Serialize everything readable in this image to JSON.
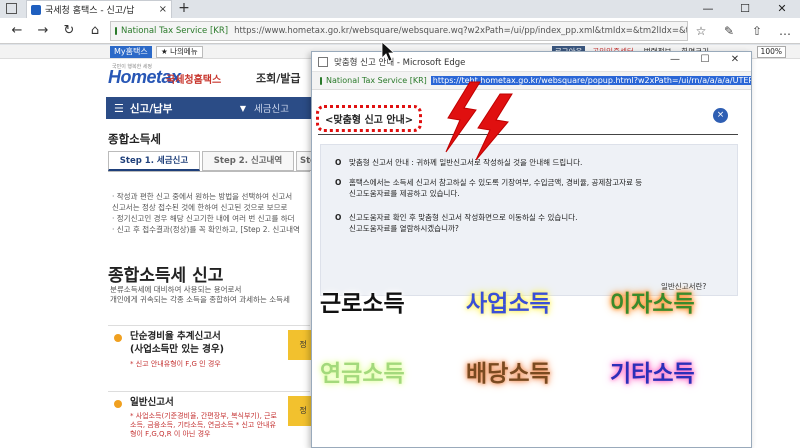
{
  "browser": {
    "tab_title": "국세청 홈택스 - 신고/납",
    "close_glyph": "×",
    "new_tab_glyph": "+",
    "window_controls": [
      "—",
      "☐",
      "✕"
    ],
    "site_identity": "National Tax Service [KR]",
    "url": "https://www.hometax.go.kr/websquare/websquare.wq?w2xPath=/ui/pp/index_pp.xml&tmIdx=&tm2lIdx=&tm3lIdx=",
    "nav": {
      "back": "←",
      "forward": "→",
      "refresh": "↻",
      "home": "⌂"
    },
    "toolbar_glyphs": [
      "☆",
      "✎",
      "⇧",
      "…"
    ]
  },
  "hometax": {
    "myhome": "My홈택스",
    "mymenu": "★ 나의메뉴",
    "toplinks": [
      "로그아웃",
      "공인인증센터",
      "법령정보",
      "화면크기"
    ],
    "zoom": "100%",
    "logo_tiny": "국민이 행복한 세정",
    "logo_main": "Hometax",
    "logo_sub": "국세청홈택스",
    "gnb_item": "조회/발급",
    "navbar_label": "신고/납부",
    "navbar_sub": "세금신고",
    "section_title": "종합소득세",
    "steps": [
      "Step 1. 세금신고",
      "Step 2. 신고내역",
      "Step"
    ],
    "bullets": [
      "· 작성과 편한 신고 중에서 원하는 방법을 선택하여 신고서",
      "  신고서는 정상 접수된 것에 한하여 신고된 것으로 보므로",
      "· 정기신고인 경우 해당 신고기한 내에 여러 번 신고를 하더",
      "· 신고 후 접수결과(정상)를 꼭 확인하고, [Step 2. 신고내역"
    ],
    "big_title": "종합소득세 신고",
    "big_desc": [
      "분류소득세에 대비하여 사용되는 용어로서",
      "개인에게 귀속되는 각종 소득을 종합하여 과세하는 소득세"
    ],
    "card1": {
      "title": [
        "단순경비율 추계신고서",
        "(사업소득만 있는 경우)"
      ],
      "note": "* 신고 안내유형이 F,G 인 경우",
      "btn": "정"
    },
    "card2": {
      "title": [
        "일반신고서"
      ],
      "note": "* 사업소득(기준경비율, 간편장부, 복식부기), 근로소득, 금융소득, 기타소득, 연금소득 * 신고 안내유형이 F,G,Q,R 이 아닌 경우",
      "btn": "정"
    }
  },
  "popup": {
    "title": "맞춤형 신고 안내 - Microsoft Edge",
    "site_identity": "National Tax Service [KR]",
    "url": "https://teht.hometax.go.kr/websquare/popup.html?w2xPath=/ui/rn/a/a/a/a/UTERNAAC02.xml&p",
    "heading": "<맞춤형 신고 안내>",
    "close_glyph": "×",
    "p1": "맞춤형 신고서 안내 : 귀하께 일반신고서로 작성하실 것을 안내해 드립니다.",
    "p2": "홈택스에서는 소득세 신고서 참고하실 수 있도록 기장여부, 수입금액, 경비율, 공제참고자료 등",
    "p2b": "신고도움자료를 제공하고 있습니다.",
    "p3": "신고도움자료 확인 후 맞춤형 신고서 작성화면으로 이동하실 수 있습니다.",
    "p3b": "신고도움자료를 열람하시겠습니까?",
    "bullet": "O",
    "link": "일반신고서란?"
  },
  "categories": {
    "earned": "근로소득",
    "business": "사업소득",
    "interest": "이자소득",
    "pension": "연금소득",
    "dividend": "배당소득",
    "other": "기타소득"
  },
  "colors": {
    "earned": "#111111",
    "business": "#3a4fd6",
    "interest": "#3b8a2c",
    "pension": "#a3d97c",
    "dividend": "#7a4a20",
    "other": "#2c2fb8",
    "hometax_blue": "#2b4c86",
    "alert_red": "#e01010"
  }
}
